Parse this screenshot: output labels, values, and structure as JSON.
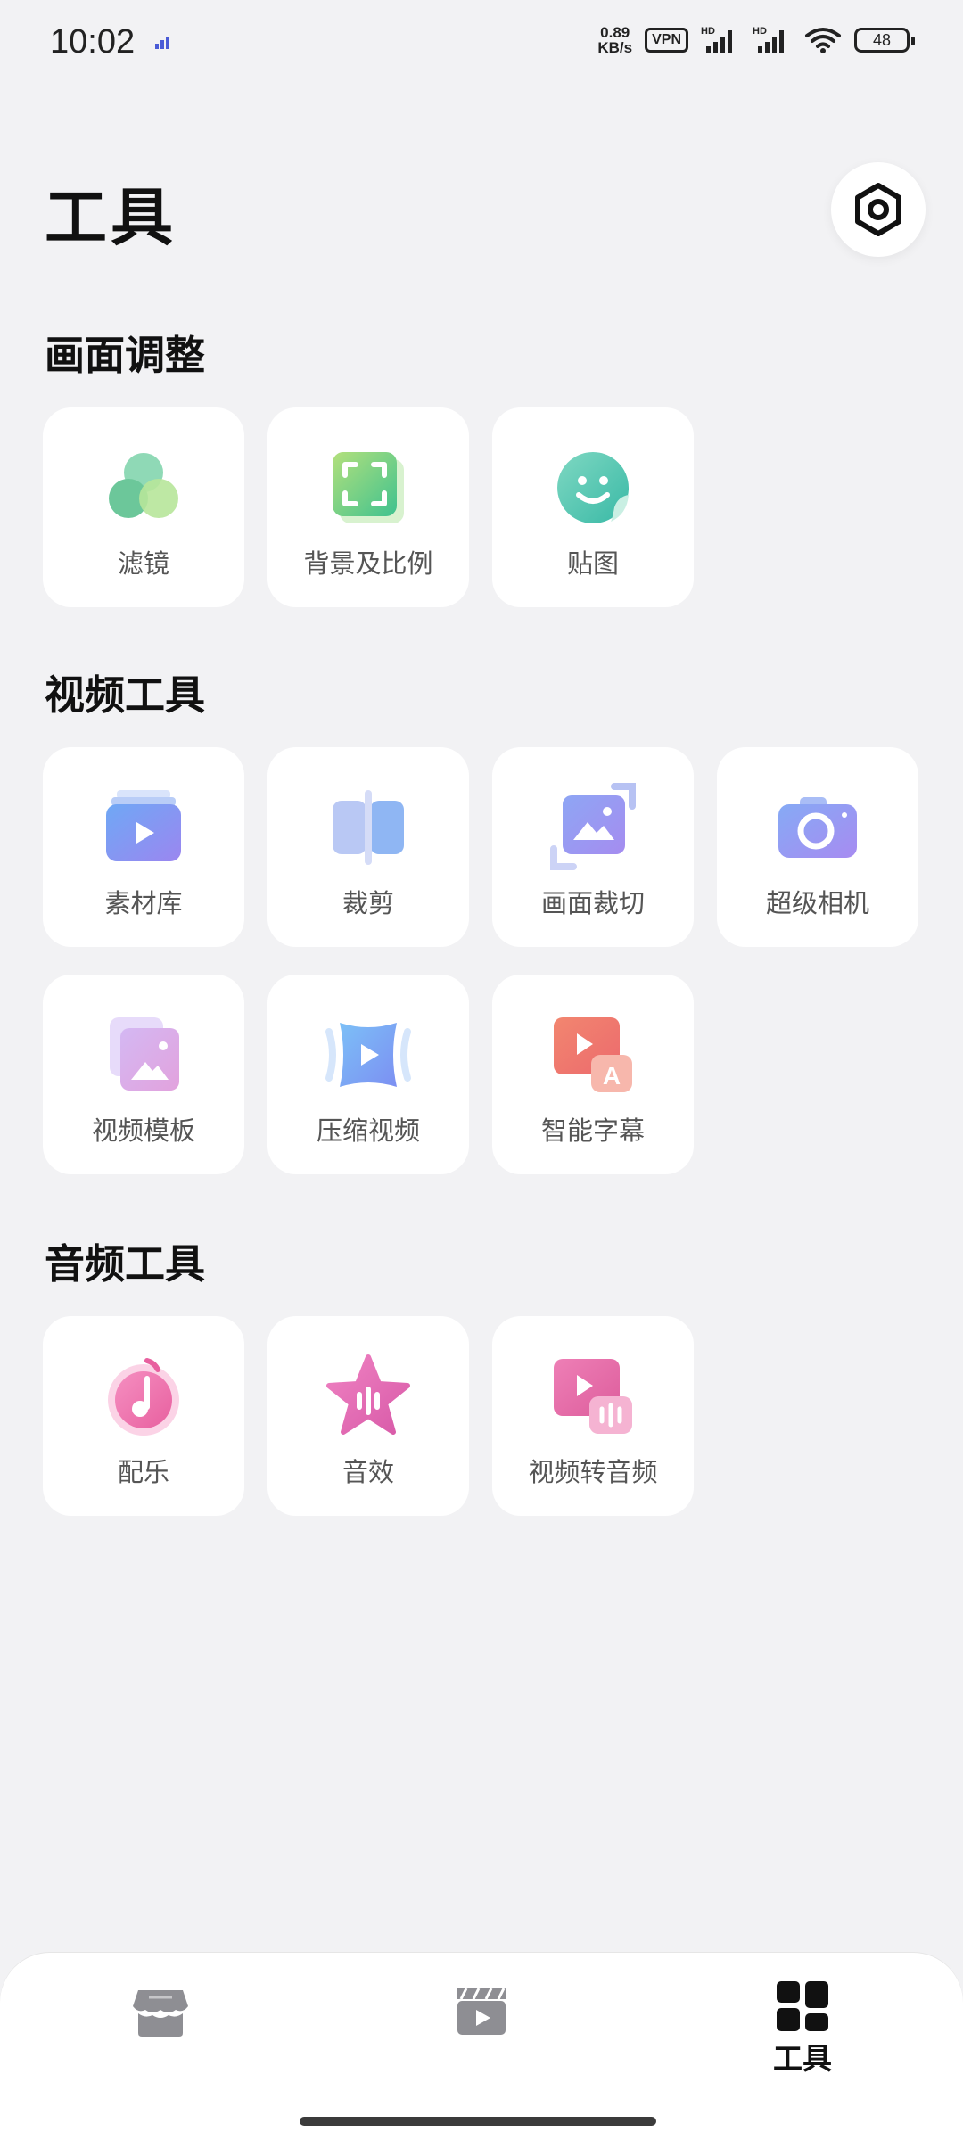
{
  "status_bar": {
    "time": "10:02",
    "net_speed_value": "0.89",
    "net_speed_unit": "KB/s",
    "vpn": "VPN",
    "hd1": "HD",
    "hd2": "HD",
    "battery": "48"
  },
  "header": {
    "title": "工具",
    "settings_icon": "hexagon-settings-icon"
  },
  "sections": [
    {
      "title": "画面调整",
      "items": [
        {
          "label": "滤镜",
          "icon": "filter-icon"
        },
        {
          "label": "背景及比例",
          "icon": "background-ratio-icon"
        },
        {
          "label": "贴图",
          "icon": "sticker-icon"
        }
      ]
    },
    {
      "title": "视频工具",
      "items": [
        {
          "label": "素材库",
          "icon": "material-library-icon"
        },
        {
          "label": "裁剪",
          "icon": "trim-icon"
        },
        {
          "label": "画面裁切",
          "icon": "crop-icon"
        },
        {
          "label": "超级相机",
          "icon": "camera-icon"
        },
        {
          "label": "视频模板",
          "icon": "video-template-icon"
        },
        {
          "label": "压缩视频",
          "icon": "compress-video-icon"
        },
        {
          "label": "智能字幕",
          "icon": "smart-subtitle-icon"
        }
      ]
    },
    {
      "title": "音频工具",
      "items": [
        {
          "label": "配乐",
          "icon": "music-icon"
        },
        {
          "label": "音效",
          "icon": "sound-effect-icon"
        },
        {
          "label": "视频转音频",
          "icon": "video-to-audio-icon"
        }
      ]
    }
  ],
  "bottom_nav": {
    "items": [
      {
        "icon": "store-icon",
        "active": false
      },
      {
        "icon": "clapperboard-icon",
        "active": false
      },
      {
        "icon": "tools-grid-icon",
        "label": "工具",
        "active": true
      }
    ]
  },
  "colors": {
    "background": "#f2f2f4",
    "card": "#ffffff",
    "nav_inactive": "#8e8e93",
    "nav_active": "#111111"
  }
}
